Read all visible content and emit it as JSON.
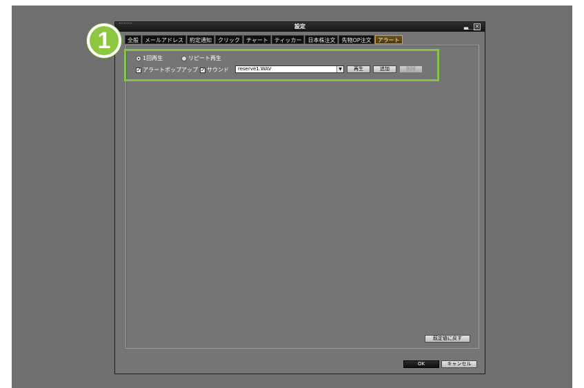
{
  "window": {
    "title": "設定",
    "minimize_icon": "minimize-icon",
    "close_icon": "close-icon"
  },
  "tabs": [
    {
      "label": "全般",
      "active": false
    },
    {
      "label": "メールアドレス",
      "active": false
    },
    {
      "label": "約定通知",
      "active": false
    },
    {
      "label": "クリック",
      "active": false
    },
    {
      "label": "チャート",
      "active": false
    },
    {
      "label": "ティッカー",
      "active": false
    },
    {
      "label": "日本株注文",
      "active": false
    },
    {
      "label": "先物OP注文",
      "active": false
    },
    {
      "label": "アラート",
      "active": true
    }
  ],
  "annotation": {
    "badge_number": "1",
    "highlight_color": "#86c34a"
  },
  "alert": {
    "play_once": {
      "label": "1回再生",
      "checked": true
    },
    "repeat_play": {
      "label": "リピート再生",
      "checked": false
    },
    "popup": {
      "label": "アラートポップアップ",
      "checked": true
    },
    "sound": {
      "label": "サウンド",
      "checked": true
    },
    "sound_file": {
      "selected": "reserve1.WAV"
    },
    "play_button": "再生",
    "add_button": "追加",
    "delete_button": "削除"
  },
  "footer": {
    "restore_defaults": "既定値に戻す",
    "ok": "OK",
    "cancel": "キャンセル"
  },
  "colors": {
    "backdrop": "#6f6f6f",
    "dialog": "#757575",
    "active_tab": "#c9a24a"
  }
}
